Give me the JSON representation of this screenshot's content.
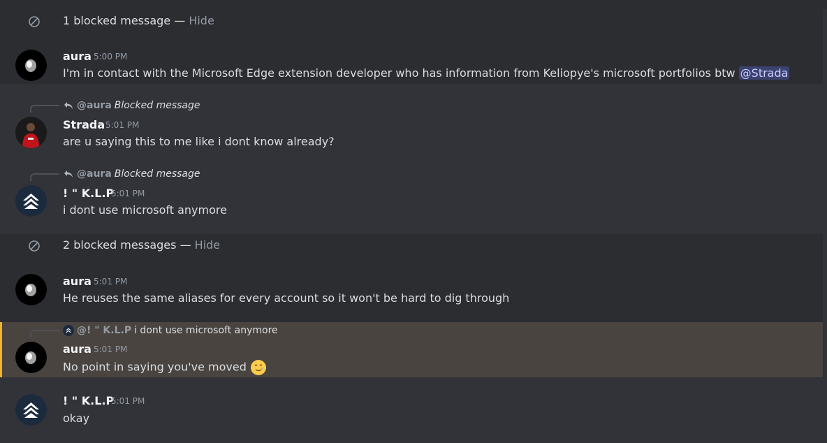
{
  "blocked_groups": [
    {
      "text": "1 blocked message",
      "separator": " — ",
      "hide": "Hide"
    },
    {
      "text": "2 blocked messages",
      "separator": " — ",
      "hide": "Hide"
    }
  ],
  "messages": [
    {
      "username": "aura",
      "timestamp": "5:00 PM",
      "content": "I'm in contact with the Microsoft Edge extension developer who has information from Keliopye's microsoft portfolios btw ",
      "mention": "@Strada"
    },
    {
      "reply": {
        "name": "@aura",
        "blocked": "Blocked message"
      },
      "username": "Strada",
      "timestamp": "5:01 PM",
      "content": "are u saying this to me like i dont know already?"
    },
    {
      "reply": {
        "name": "@aura",
        "blocked": "Blocked message"
      },
      "username": "! \" K.L.P",
      "timestamp": "5:01 PM",
      "content": "i dont use microsoft anymore"
    },
    {
      "username": "aura",
      "timestamp": "5:01 PM",
      "content": "He reuses the same aliases for every account so it won't be hard to dig through"
    },
    {
      "reply": {
        "name": "@! \" K.L.P",
        "text": "i dont use microsoft anymore"
      },
      "username": "aura",
      "timestamp": "5:01 PM",
      "content": "No point in saying you've moved",
      "emoji": "smiling-face-with-tear"
    },
    {
      "username": "! \" K.L.P",
      "timestamp": "5:01 PM",
      "content": "okay"
    }
  ],
  "colors": {
    "background": "#313338",
    "blocked_band": "#2b2d31",
    "highlight": "#4a4440",
    "highlight_bar": "#f0b232",
    "mention_bg": "#3c4270"
  }
}
